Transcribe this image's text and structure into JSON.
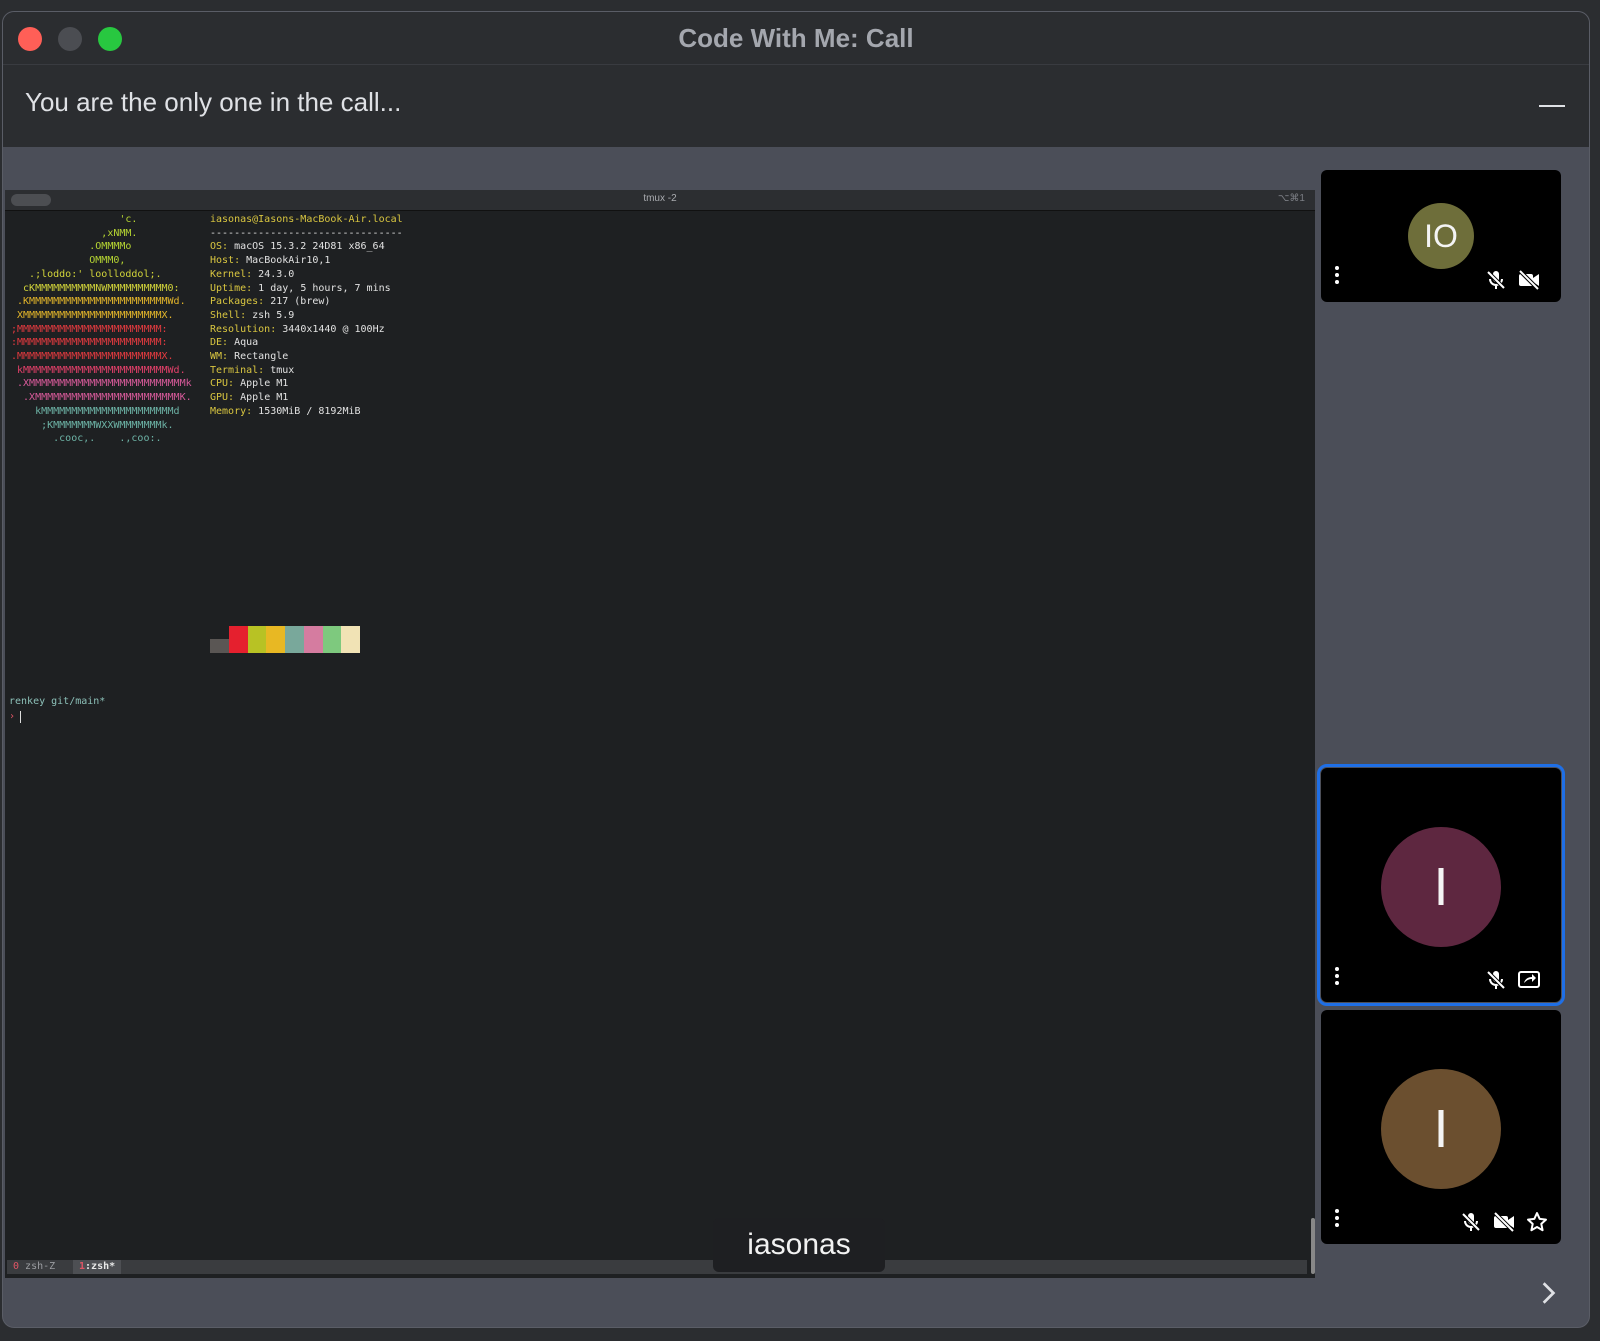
{
  "window": {
    "title": "Code With Me: Call"
  },
  "call": {
    "status": "You are the only one in the call...",
    "speaker_label": "iasonas"
  },
  "terminal": {
    "tab_title": "tmux -2",
    "shortcut": "⌥⌘1",
    "ascii_logo": [
      {
        "text": "                  'c.",
        "color": "#b6d532"
      },
      {
        "text": "               ,xNMM.",
        "color": "#b6d532"
      },
      {
        "text": "             .OMMMMo",
        "color": "#b6d532"
      },
      {
        "text": "             OMMM0,",
        "color": "#b6d532"
      },
      {
        "text": "   .;loddo:' loolloddol;.",
        "color": "#d2d43a"
      },
      {
        "text": "  cKMMMMMMMMMMNWMMMMMMMMMM0:",
        "color": "#d2d43a"
      },
      {
        "text": " .KMMMMMMMMMMMMMMMMMMMMMMMWd.",
        "color": "#e3b52a"
      },
      {
        "text": " XMMMMMMMMMMMMMMMMMMMMMMMX.",
        "color": "#e3b52a"
      },
      {
        "text": ";MMMMMMMMMMMMMMMMMMMMMMMM:",
        "color": "#e33a3f"
      },
      {
        "text": ":MMMMMMMMMMMMMMMMMMMMMMMM:",
        "color": "#e33a3f"
      },
      {
        "text": ".MMMMMMMMMMMMMMMMMMMMMMMMX.",
        "color": "#e33a3f"
      },
      {
        "text": " kMMMMMMMMMMMMMMMMMMMMMMMMWd.",
        "color": "#e4406a"
      },
      {
        "text": " .XMMMMMMMMMMMMMMMMMMMMMMMMMMk",
        "color": "#d85a9a"
      },
      {
        "text": "  .XMMMMMMMMMMMMMMMMMMMMMMMMK.",
        "color": "#d85a9a"
      },
      {
        "text": "    kMMMMMMMMMMMMMMMMMMMMMMd",
        "color": "#6db3a6"
      },
      {
        "text": "     ;KMMMMMMMWXXWMMMMMMMk.",
        "color": "#6db3a6"
      },
      {
        "text": "       .cooc,.    .,coo:.",
        "color": "#6db3a6"
      }
    ],
    "header": "iasonas@Iasons-MacBook-Air.local",
    "separator": "--------------------------------",
    "info": [
      {
        "key": "OS",
        "value": "macOS 15.3.2 24D81 x86_64"
      },
      {
        "key": "Host",
        "value": "MacBookAir10,1"
      },
      {
        "key": "Kernel",
        "value": "24.3.0"
      },
      {
        "key": "Uptime",
        "value": "1 day, 5 hours, 7 mins"
      },
      {
        "key": "Packages",
        "value": "217 (brew)"
      },
      {
        "key": "Shell",
        "value": "zsh 5.9"
      },
      {
        "key": "Resolution",
        "value": "3440x1440 @ 100Hz"
      },
      {
        "key": "DE",
        "value": "Aqua"
      },
      {
        "key": "WM",
        "value": "Rectangle"
      },
      {
        "key": "Terminal",
        "value": "tmux"
      },
      {
        "key": "CPU",
        "value": "Apple M1"
      },
      {
        "key": "GPU",
        "value": "Apple M1"
      },
      {
        "key": "Memory",
        "value": "1530MiB / 8192MiB"
      }
    ],
    "palette": [
      "#5a5654",
      "#e5202e",
      "#b8c224",
      "#e8b823",
      "#79a89b",
      "#d57ca0",
      "#7ec97e",
      "#f1e3b5"
    ],
    "prompt_dir": "renkey git/main*",
    "prompt_caret": "›",
    "status_left_num": "0",
    "status_left_name": " zsh-Z",
    "status_win_num": "1",
    "status_win_name": ":zsh*"
  },
  "participants": [
    {
      "initials": "IO",
      "avatar_color": "#6e6e3a",
      "icons": [
        "mic-off-icon",
        "camera-off-icon"
      ]
    },
    {
      "initials": "I",
      "avatar_color": "#5e2740",
      "icons": [
        "mic-off-icon",
        "screen-share-icon"
      ],
      "selected": true
    },
    {
      "initials": "I",
      "avatar_color": "#6b4f2f",
      "icons": [
        "mic-off-icon",
        "camera-off-icon",
        "star-icon"
      ]
    }
  ],
  "colors": {
    "accent": "#1f6fe6",
    "terminal_key": "#d9c640"
  }
}
